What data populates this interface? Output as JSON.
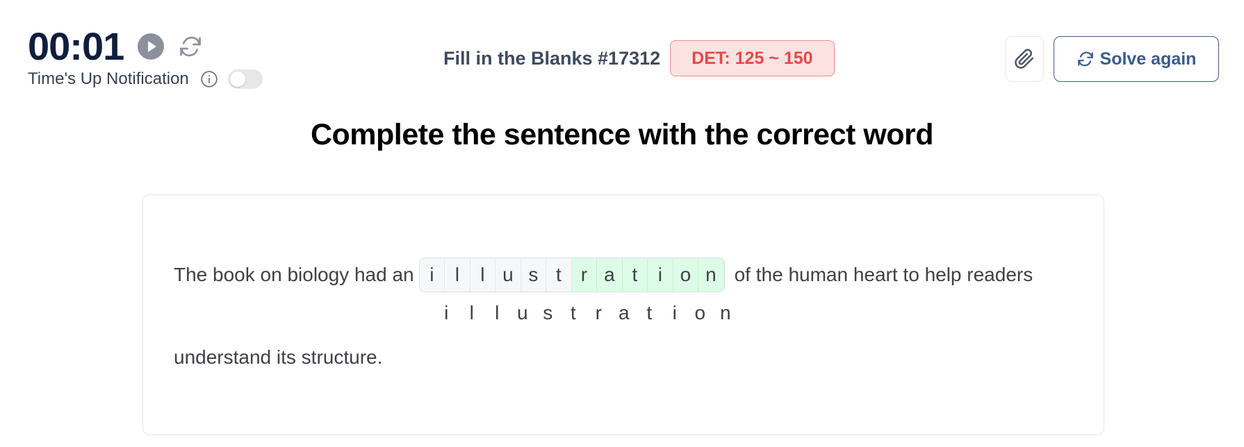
{
  "timer": {
    "time": "00:01",
    "notification_label": "Time's Up Notification",
    "toggle_on": false
  },
  "header": {
    "title": "Fill in the Blanks #17312",
    "badge": "DET: 125 ~ 150",
    "solve_again_label": "Solve again"
  },
  "prompt": "Complete the sentence with the correct word",
  "sentence": {
    "before": "The book on biology had an",
    "after": "of the human heart to help readers",
    "line2": "understand its structure.",
    "blank_cells": [
      {
        "letter": "i",
        "filled": false
      },
      {
        "letter": "l",
        "filled": false
      },
      {
        "letter": "l",
        "filled": false
      },
      {
        "letter": "u",
        "filled": false
      },
      {
        "letter": "s",
        "filled": false
      },
      {
        "letter": "t",
        "filled": false
      },
      {
        "letter": "r",
        "filled": true
      },
      {
        "letter": "a",
        "filled": true
      },
      {
        "letter": "t",
        "filled": true
      },
      {
        "letter": "i",
        "filled": true
      },
      {
        "letter": "o",
        "filled": true
      },
      {
        "letter": "n",
        "filled": true
      }
    ],
    "answer_letters": [
      "i",
      "l",
      "l",
      "u",
      "s",
      "t",
      "r",
      "a",
      "t",
      "i",
      "o",
      "n"
    ]
  },
  "colors": {
    "accent": "#3b5b8c",
    "badge_bg": "#fde2e2",
    "badge_text": "#e5484d",
    "filled_cell": "#dcfce7"
  },
  "icons": {
    "play": "play-icon",
    "reset": "refresh-icon",
    "info": "info-icon",
    "attach": "paperclip-icon",
    "solve": "refresh-icon"
  }
}
